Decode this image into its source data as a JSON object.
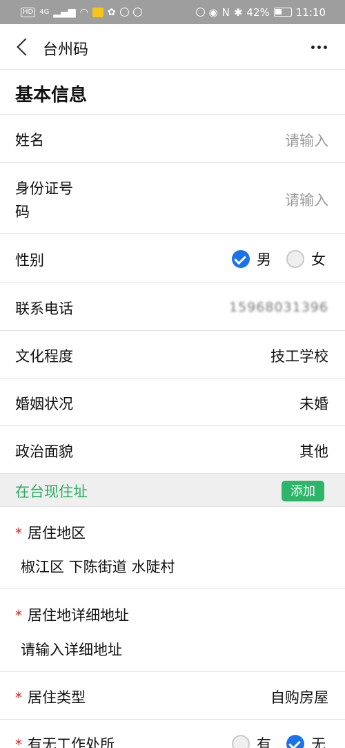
{
  "status_bar": {
    "left_chips": [
      "HD",
      "4G"
    ],
    "app_badge": "美团",
    "battery_pct": "42%",
    "time": "11:10"
  },
  "nav": {
    "title": "台州码",
    "back_icon": "chevron-left-icon",
    "more_icon": "more-horizontal-icon"
  },
  "section": {
    "title": "基本信息"
  },
  "fields": {
    "name": {
      "label": "姓名",
      "placeholder": "请输入"
    },
    "id_number": {
      "label_line1": "身份证号",
      "label_line2": "码",
      "placeholder": "请输入"
    },
    "gender": {
      "label": "性别",
      "options": [
        "男",
        "女"
      ],
      "selected": "男"
    },
    "phone": {
      "label": "联系电话",
      "value": "15968031396"
    },
    "education": {
      "label": "文化程度",
      "value": "技工学校"
    },
    "marital": {
      "label": "婚姻状况",
      "value": "未婚"
    },
    "political": {
      "label": "政治面貌",
      "value": "其他"
    }
  },
  "address_section": {
    "title": "在台现住址",
    "add_label": "添加"
  },
  "address": {
    "region": {
      "label": "居住地区",
      "value": "椒江区 下陈街道 水陡村"
    },
    "detail": {
      "label": "居住地详细地址",
      "placeholder": "请输入详细地址"
    },
    "type": {
      "label": "居住类型",
      "value": "自购房屋"
    },
    "workplace": {
      "label": "有无工作处所",
      "options": [
        "有",
        "无"
      ],
      "selected": "无"
    }
  },
  "colors": {
    "status_bar_bg": "#9e9e9e",
    "accent_green": "#2db56a",
    "radio_blue": "#1a73e8",
    "required_red": "#e02020"
  }
}
